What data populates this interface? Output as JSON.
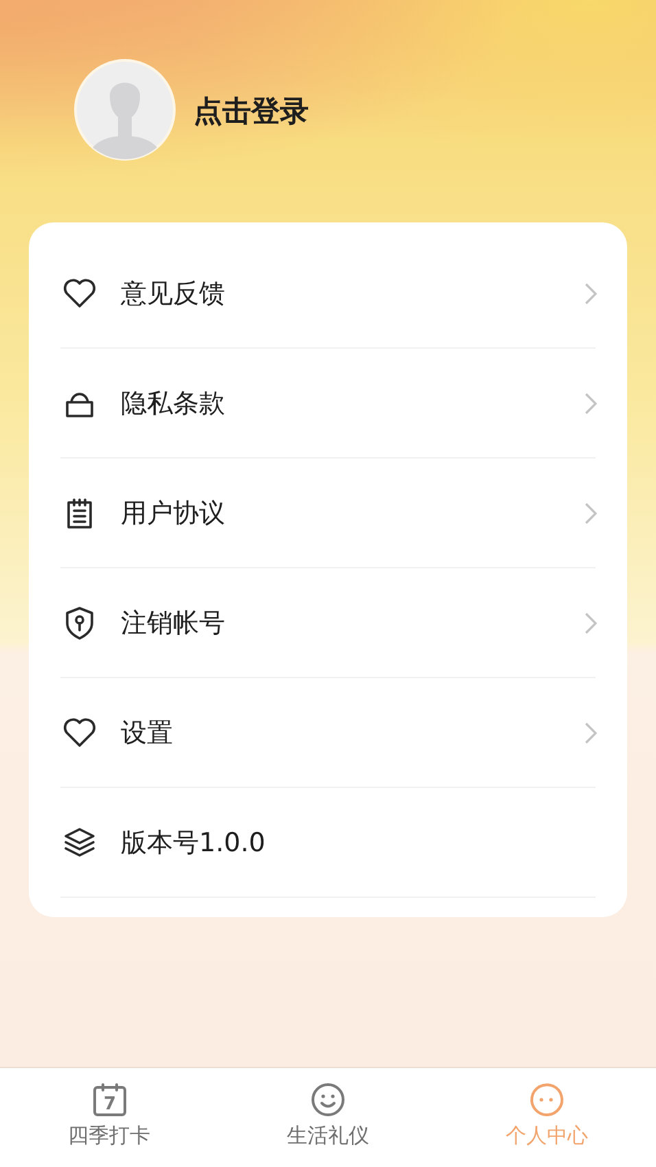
{
  "profile": {
    "login_label": "点击登录"
  },
  "menu": [
    {
      "kind": "heart",
      "label": "意见反馈",
      "chevron": true
    },
    {
      "kind": "bag",
      "label": "隐私条款",
      "chevron": true
    },
    {
      "kind": "notepad",
      "label": "用户协议",
      "chevron": true
    },
    {
      "kind": "shield",
      "label": "注销帐号",
      "chevron": true
    },
    {
      "kind": "heart",
      "label": "设置",
      "chevron": true
    },
    {
      "kind": "layers",
      "label": "版本号1.0.0",
      "chevron": false
    }
  ],
  "tab_bar": [
    {
      "kind": "calendar",
      "icon_text": "7",
      "label": "四季打卡",
      "selected": false
    },
    {
      "kind": "smile",
      "label": "生活礼仪",
      "selected": false
    },
    {
      "kind": "face",
      "label": "个人中心",
      "selected": true
    }
  ]
}
